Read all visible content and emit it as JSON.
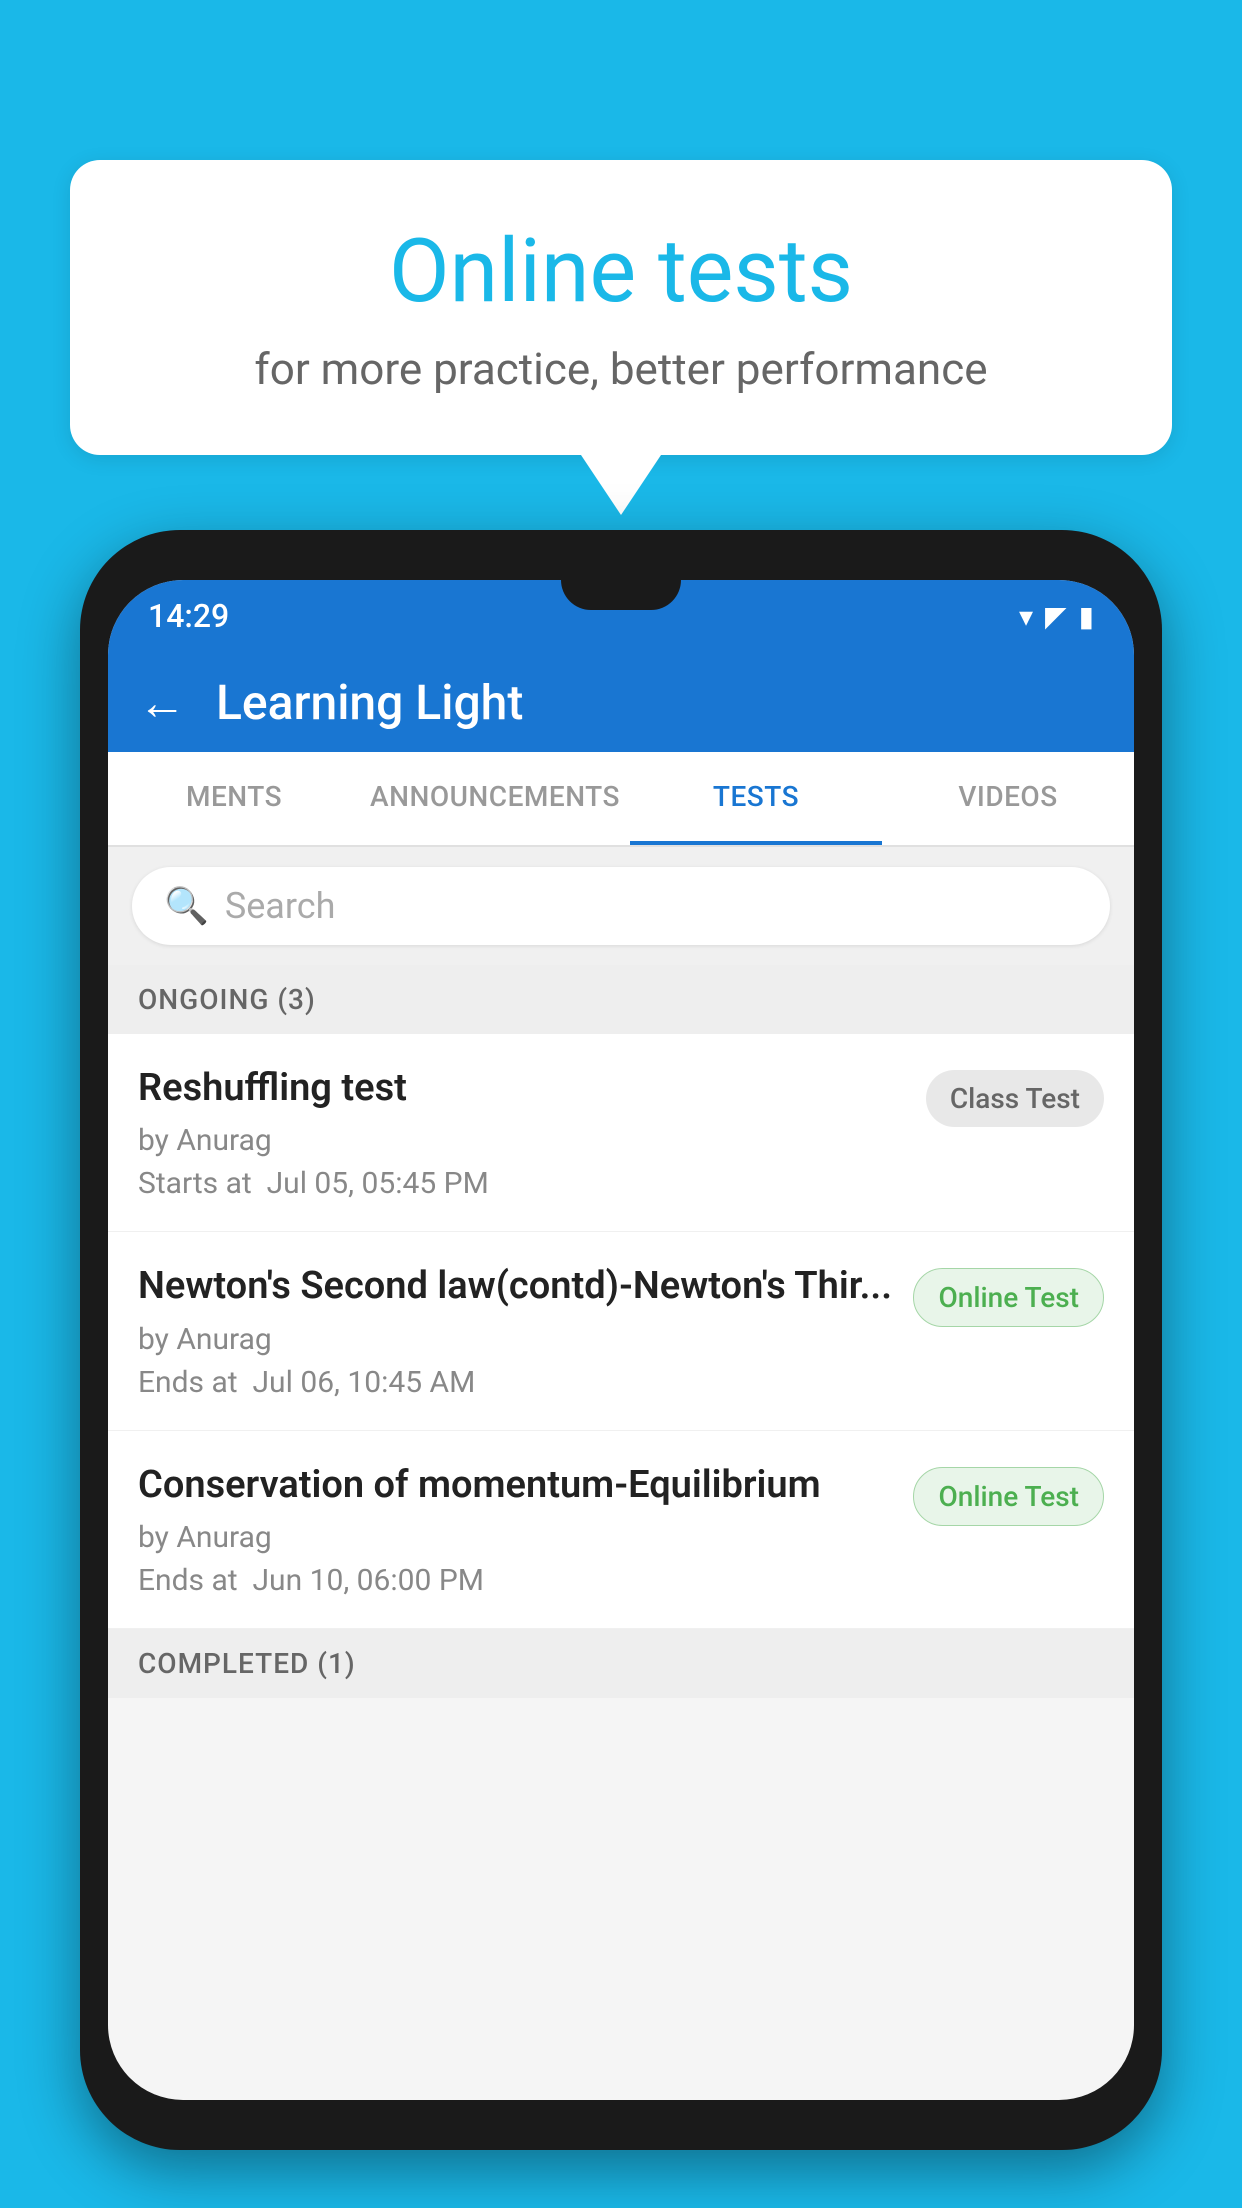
{
  "background": {
    "color": "#1ab8e8"
  },
  "speech_bubble": {
    "title": "Online tests",
    "subtitle": "for more practice, better performance"
  },
  "phone": {
    "status_bar": {
      "time": "14:29",
      "wifi_icon": "▾",
      "signal_icon": "▲",
      "battery_icon": "▮"
    },
    "header": {
      "back_label": "←",
      "title": "Learning Light"
    },
    "tabs": [
      {
        "label": "MENTS",
        "active": false
      },
      {
        "label": "ANNOUNCEMENTS",
        "active": false
      },
      {
        "label": "TESTS",
        "active": true
      },
      {
        "label": "VIDEOS",
        "active": false
      }
    ],
    "search": {
      "placeholder": "Search"
    },
    "section_ongoing": {
      "label": "ONGOING (3)"
    },
    "tests": [
      {
        "name": "Reshuffling test",
        "author": "by Anurag",
        "time_label": "Starts at",
        "time": "Jul 05, 05:45 PM",
        "badge": "Class Test",
        "badge_type": "class"
      },
      {
        "name": "Newton's Second law(contd)-Newton's Thir...",
        "author": "by Anurag",
        "time_label": "Ends at",
        "time": "Jul 06, 10:45 AM",
        "badge": "Online Test",
        "badge_type": "online"
      },
      {
        "name": "Conservation of momentum-Equilibrium",
        "author": "by Anurag",
        "time_label": "Ends at",
        "time": "Jun 10, 06:00 PM",
        "badge": "Online Test",
        "badge_type": "online"
      }
    ],
    "section_completed": {
      "label": "COMPLETED (1)"
    }
  }
}
